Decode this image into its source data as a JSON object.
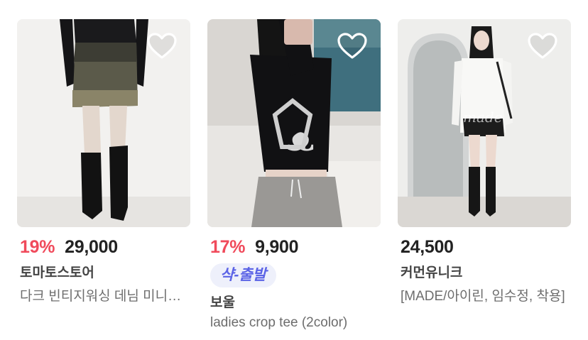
{
  "products": [
    {
      "discount": "19%",
      "price": "29,000",
      "store": "토마토스토어",
      "title": "다크 빈티지워싱 데님 미니스커트",
      "image": "woman in dark vintage-washed denim mini skirt and black knee-high boots"
    },
    {
      "discount": "17%",
      "price": "9,900",
      "badge": "샥-출발",
      "store": "보울",
      "title": "ladies crop tee (2color)",
      "image": "woman taking mirror selfie in black crop tee and grey sweatpants"
    },
    {
      "price": "24,500",
      "store": "커먼유니크",
      "title": "[MADE/아이린, 임수정, 착용]",
      "image": "woman in white shirt, black mini skirt and black knee-high boots by an arched window"
    }
  ],
  "icons": {
    "wishlist": "heart-outline-icon"
  },
  "colors": {
    "discount": "#f04a5b",
    "badge_text": "#5b63e6",
    "badge_bg": "#eef0fb"
  }
}
